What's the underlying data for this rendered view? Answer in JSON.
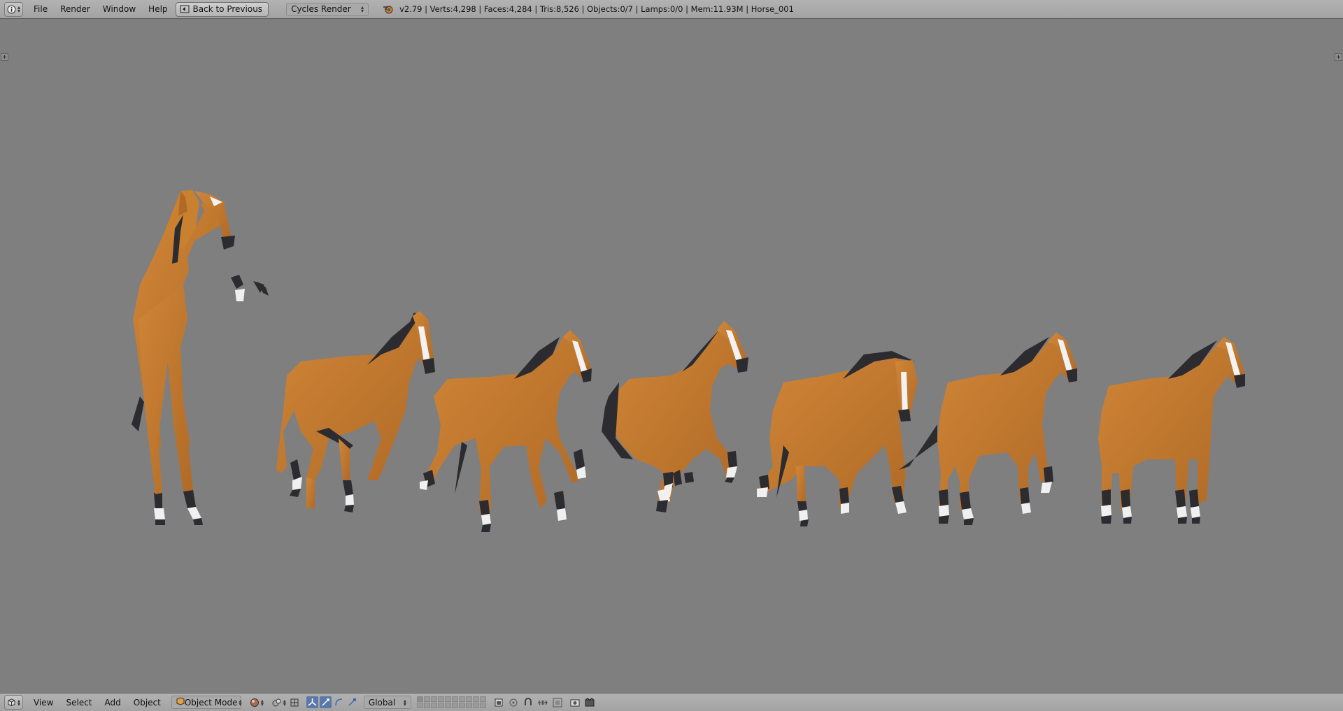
{
  "colors": {
    "header_bg": "#a9a9a9",
    "viewport_bg": "#7f7f7f",
    "horse_body": "#c47a30",
    "horse_mane": "#2b2b30",
    "horse_socks": "#f0f0f0",
    "active_tool": "#5a78a8"
  },
  "header": {
    "editor_icon": "info-icon",
    "menu": [
      "File",
      "Render",
      "Window",
      "Help"
    ],
    "back_button": "Back to Previous",
    "render_engine": "Cycles Render",
    "stats": "v2.79 | Verts:4,298 | Faces:4,284 | Tris:8,526 | Objects:0/7 | Lamps:0/0 | Mem:11.93M | Horse_001"
  },
  "viewport": {
    "horses": [
      {
        "name": "horse-rearing",
        "pose": "rearing"
      },
      {
        "name": "horse-trotting-1",
        "pose": "trot"
      },
      {
        "name": "horse-walking-1",
        "pose": "walk"
      },
      {
        "name": "horse-galloping",
        "pose": "gallop"
      },
      {
        "name": "horse-head-down",
        "pose": "graze"
      },
      {
        "name": "horse-walking-2",
        "pose": "walk"
      },
      {
        "name": "horse-standing",
        "pose": "stand"
      }
    ]
  },
  "footer": {
    "editor_icon": "3d-view-icon",
    "menu": [
      "View",
      "Select",
      "Add",
      "Object"
    ],
    "mode": "Object Mode",
    "orientation": "Global"
  }
}
